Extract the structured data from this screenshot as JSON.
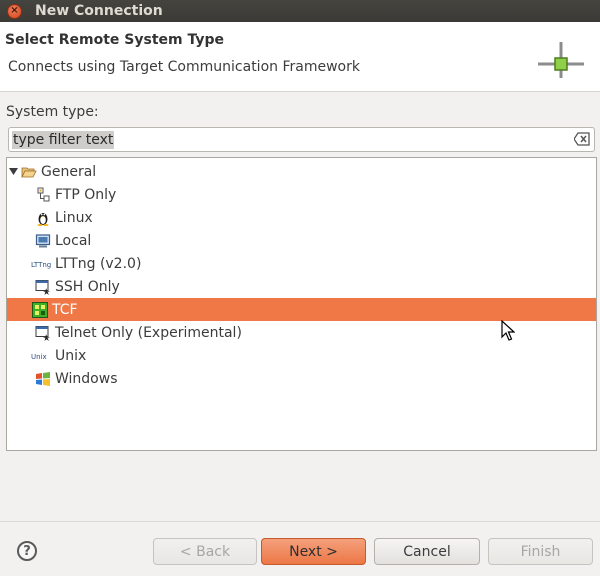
{
  "window": {
    "title": "New Connection"
  },
  "banner": {
    "title": "Select Remote System Type",
    "description": "Connects using Target Communication Framework",
    "icon": "network-connection-icon"
  },
  "system_type": {
    "label": "System type:",
    "filter_value": "type filter text"
  },
  "tree": {
    "group": {
      "label": "General",
      "expanded": true,
      "icon": "folder-open-icon"
    },
    "items": [
      {
        "label": "FTP Only",
        "icon": "ftp-icon"
      },
      {
        "label": "Linux",
        "icon": "linux-tux-icon"
      },
      {
        "label": "Local",
        "icon": "computer-monitor-icon"
      },
      {
        "label": "LTTng (v2.0)",
        "icon": "lttng-icon",
        "icon_text": "LTTng"
      },
      {
        "label": "SSH Only",
        "icon": "ssh-terminal-icon"
      },
      {
        "label": "TCF",
        "icon": "tcf-icon",
        "selected": true
      },
      {
        "label": "Telnet Only (Experimental)",
        "icon": "telnet-terminal-icon"
      },
      {
        "label": "Unix",
        "icon": "unix-icon",
        "icon_text": "Unix"
      },
      {
        "label": "Windows",
        "icon": "windows-flag-icon"
      }
    ]
  },
  "buttons": {
    "help": "?",
    "back": "< Back",
    "next": "Next >",
    "cancel": "Cancel",
    "finish": "Finish"
  },
  "colors": {
    "selection": "#f07746",
    "titlebar": "#3c3b37",
    "primary_button": "#ec7747"
  }
}
